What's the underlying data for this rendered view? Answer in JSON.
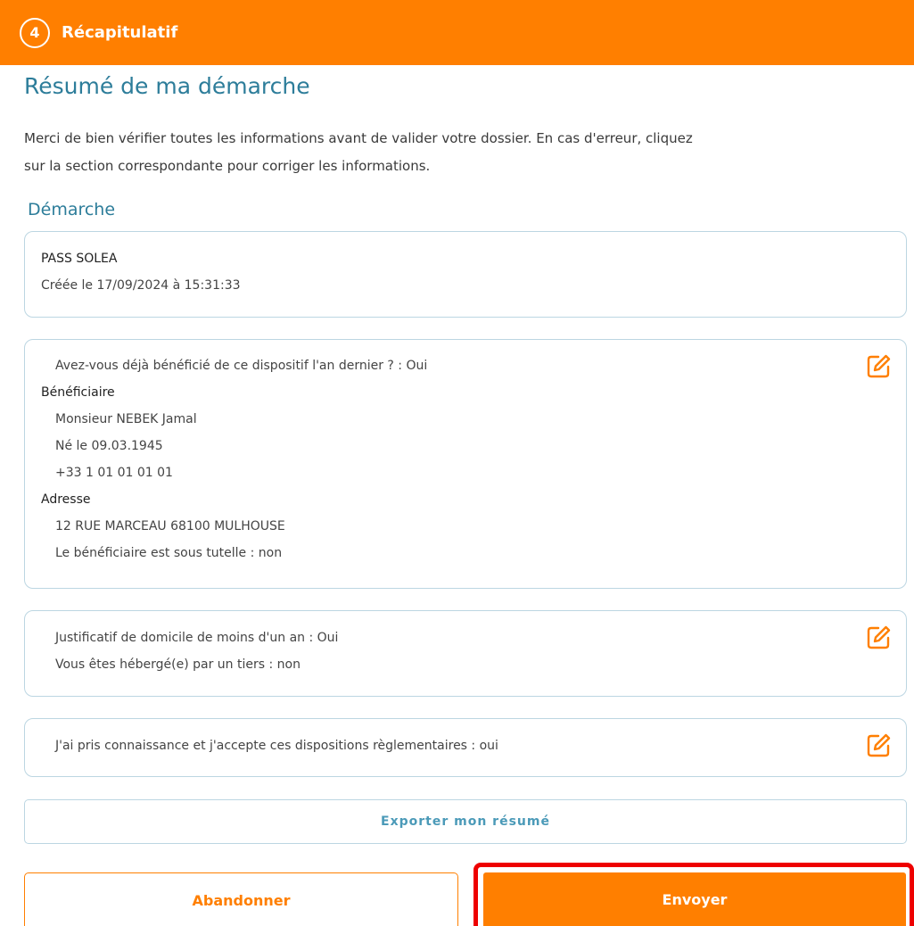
{
  "step": {
    "number": "4",
    "title": "Récapitulatif"
  },
  "page_title": "Résumé de ma démarche",
  "intro": {
    "line1": "Merci de bien vérifier toutes les informations avant de valider votre dossier. En cas d'erreur, cliquez",
    "line2": "sur la section correspondante pour corriger les informations."
  },
  "section_title": "Démarche",
  "demarche_card": {
    "name": "PASS SOLEA",
    "created": "Créée le 17/09/2024 à 15:31:33"
  },
  "beneficiary_card": {
    "previous_benefit": "Avez-vous déjà bénéficié de ce dispositif l'an dernier ? : Oui",
    "beneficiary_label": "Bénéficiaire",
    "beneficiary_name": "Monsieur NEBEK Jamal",
    "birth": "Né le 09.03.1945",
    "phone": "+33 1 01 01 01 01",
    "address_label": "Adresse",
    "address": "12 RUE MARCEAU 68100 MULHOUSE",
    "guardianship": "Le bénéficiaire est sous tutelle : non"
  },
  "housing_card": {
    "proof": "Justificatif de domicile de moins d'un an : Oui",
    "hosted": "Vous êtes hébergé(e) par un tiers : non"
  },
  "terms_card": {
    "accept": "J'ai pris connaissance et j'accepte ces dispositions règlementaires : oui"
  },
  "actions": {
    "export_label": "Exporter mon résumé",
    "abandon_label": "Abandonner",
    "send_label": "Envoyer"
  },
  "icons": {
    "edit": "edit-pencil-icon"
  },
  "colors": {
    "accent_orange": "#ff7f00",
    "title_blue": "#2d7d9a",
    "border_blue": "#bcd6e2",
    "highlight_red": "#ee0000"
  }
}
